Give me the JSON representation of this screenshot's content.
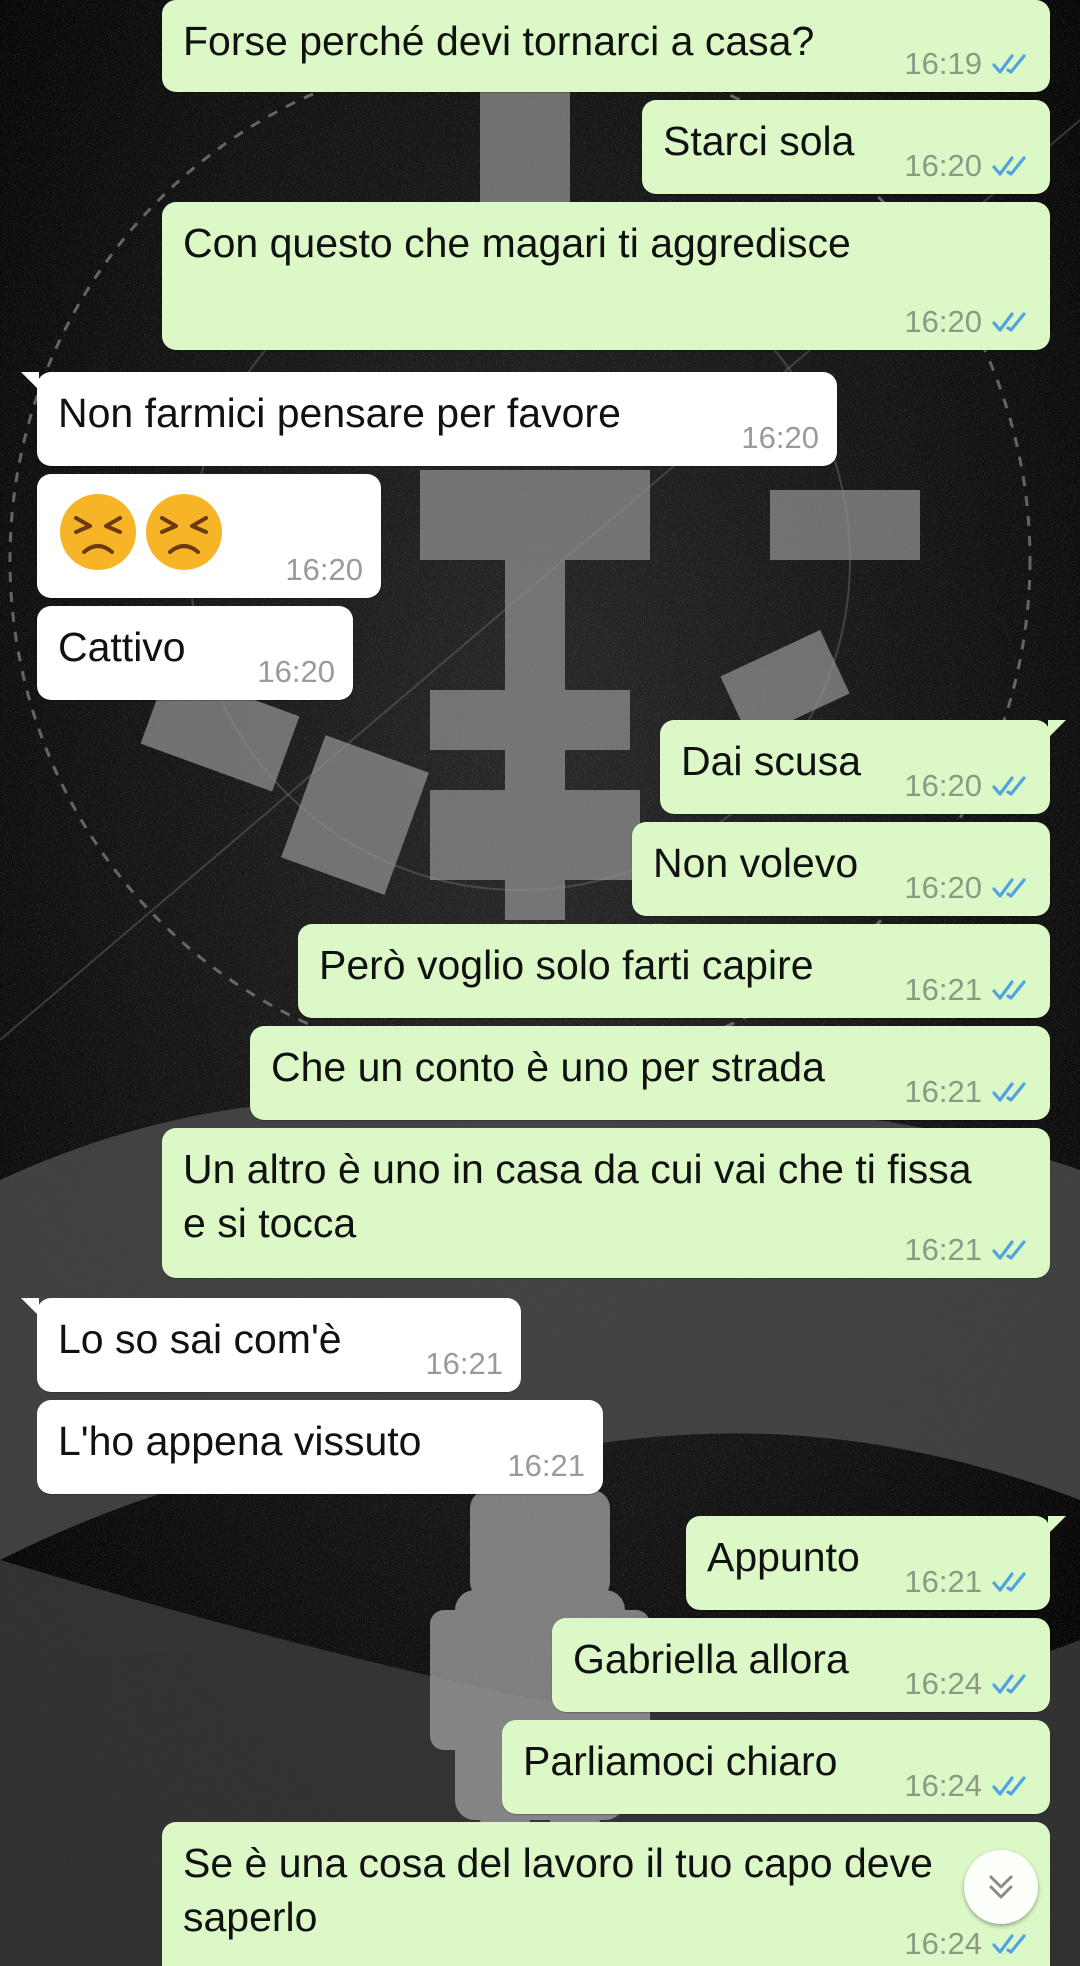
{
  "colors": {
    "outgoing_bubble": "#dcf8c6",
    "incoming_bubble": "#ffffff",
    "read_ticks": "#4fa3e0"
  },
  "icons": {
    "read_receipt": "double-check-icon",
    "scroll_down": "double-chevron-down-icon",
    "emoji": "persevering-face-emoji"
  },
  "messages": [
    {
      "dir": "out",
      "text": "Forse perché devi tornarci a casa?",
      "time": "16:19",
      "status": "read"
    },
    {
      "dir": "out",
      "text": "Starci sola",
      "time": "16:20",
      "status": "read"
    },
    {
      "dir": "out",
      "text": "Con questo che magari ti aggredisce",
      "time": "16:20",
      "status": "read"
    },
    {
      "dir": "in",
      "text": "Non farmici pensare per favore",
      "time": "16:20"
    },
    {
      "dir": "in",
      "text": "😣😣",
      "time": "16:20",
      "kind": "emoji"
    },
    {
      "dir": "in",
      "text": "Cattivo",
      "time": "16:20"
    },
    {
      "dir": "out",
      "text": "Dai scusa",
      "time": "16:20",
      "status": "read"
    },
    {
      "dir": "out",
      "text": "Non volevo",
      "time": "16:20",
      "status": "read"
    },
    {
      "dir": "out",
      "text": "Però voglio solo farti capire",
      "time": "16:21",
      "status": "read"
    },
    {
      "dir": "out",
      "text": "Che un conto è uno per strada",
      "time": "16:21",
      "status": "read"
    },
    {
      "dir": "out",
      "text": "Un altro è uno in casa da cui vai che ti fissa e si tocca",
      "time": "16:21",
      "status": "read"
    },
    {
      "dir": "in",
      "text": "Lo so sai com'è",
      "time": "16:21"
    },
    {
      "dir": "in",
      "text": "L'ho appena vissuto",
      "time": "16:21"
    },
    {
      "dir": "out",
      "text": "Appunto",
      "time": "16:21",
      "status": "read"
    },
    {
      "dir": "out",
      "text": "Gabriella allora",
      "time": "16:24",
      "status": "read"
    },
    {
      "dir": "out",
      "text": "Parliamoci chiaro",
      "time": "16:24",
      "status": "read"
    },
    {
      "dir": "out",
      "text": "Se è una cosa del lavoro il tuo capo deve saperlo",
      "time": "16:24",
      "status": "read"
    }
  ]
}
